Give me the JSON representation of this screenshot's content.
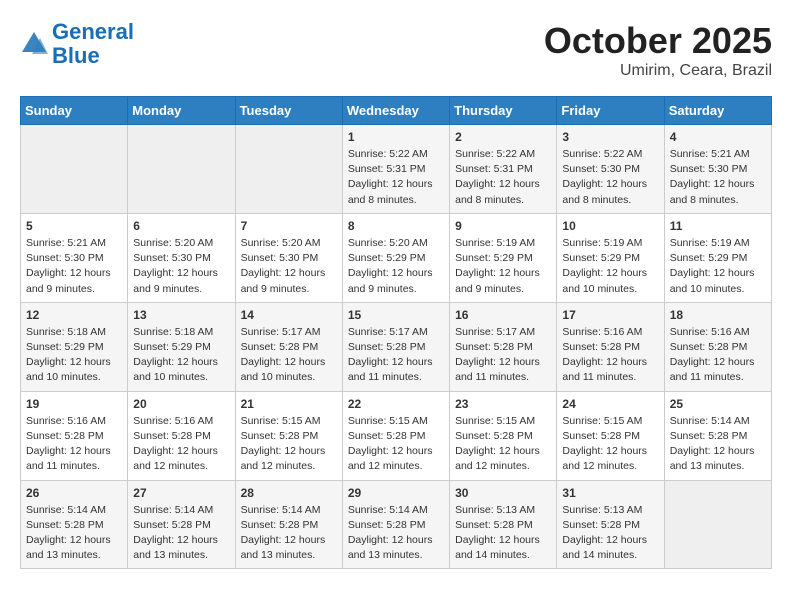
{
  "header": {
    "logo_line1": "General",
    "logo_line2": "Blue",
    "month": "October 2025",
    "location": "Umirim, Ceara, Brazil"
  },
  "days_of_week": [
    "Sunday",
    "Monday",
    "Tuesday",
    "Wednesday",
    "Thursday",
    "Friday",
    "Saturday"
  ],
  "weeks": [
    [
      {
        "day": "",
        "info": ""
      },
      {
        "day": "",
        "info": ""
      },
      {
        "day": "",
        "info": ""
      },
      {
        "day": "1",
        "info": "Sunrise: 5:22 AM\nSunset: 5:31 PM\nDaylight: 12 hours and 8 minutes."
      },
      {
        "day": "2",
        "info": "Sunrise: 5:22 AM\nSunset: 5:31 PM\nDaylight: 12 hours and 8 minutes."
      },
      {
        "day": "3",
        "info": "Sunrise: 5:22 AM\nSunset: 5:30 PM\nDaylight: 12 hours and 8 minutes."
      },
      {
        "day": "4",
        "info": "Sunrise: 5:21 AM\nSunset: 5:30 PM\nDaylight: 12 hours and 8 minutes."
      }
    ],
    [
      {
        "day": "5",
        "info": "Sunrise: 5:21 AM\nSunset: 5:30 PM\nDaylight: 12 hours and 9 minutes."
      },
      {
        "day": "6",
        "info": "Sunrise: 5:20 AM\nSunset: 5:30 PM\nDaylight: 12 hours and 9 minutes."
      },
      {
        "day": "7",
        "info": "Sunrise: 5:20 AM\nSunset: 5:30 PM\nDaylight: 12 hours and 9 minutes."
      },
      {
        "day": "8",
        "info": "Sunrise: 5:20 AM\nSunset: 5:29 PM\nDaylight: 12 hours and 9 minutes."
      },
      {
        "day": "9",
        "info": "Sunrise: 5:19 AM\nSunset: 5:29 PM\nDaylight: 12 hours and 9 minutes."
      },
      {
        "day": "10",
        "info": "Sunrise: 5:19 AM\nSunset: 5:29 PM\nDaylight: 12 hours and 10 minutes."
      },
      {
        "day": "11",
        "info": "Sunrise: 5:19 AM\nSunset: 5:29 PM\nDaylight: 12 hours and 10 minutes."
      }
    ],
    [
      {
        "day": "12",
        "info": "Sunrise: 5:18 AM\nSunset: 5:29 PM\nDaylight: 12 hours and 10 minutes."
      },
      {
        "day": "13",
        "info": "Sunrise: 5:18 AM\nSunset: 5:29 PM\nDaylight: 12 hours and 10 minutes."
      },
      {
        "day": "14",
        "info": "Sunrise: 5:17 AM\nSunset: 5:28 PM\nDaylight: 12 hours and 10 minutes."
      },
      {
        "day": "15",
        "info": "Sunrise: 5:17 AM\nSunset: 5:28 PM\nDaylight: 12 hours and 11 minutes."
      },
      {
        "day": "16",
        "info": "Sunrise: 5:17 AM\nSunset: 5:28 PM\nDaylight: 12 hours and 11 minutes."
      },
      {
        "day": "17",
        "info": "Sunrise: 5:16 AM\nSunset: 5:28 PM\nDaylight: 12 hours and 11 minutes."
      },
      {
        "day": "18",
        "info": "Sunrise: 5:16 AM\nSunset: 5:28 PM\nDaylight: 12 hours and 11 minutes."
      }
    ],
    [
      {
        "day": "19",
        "info": "Sunrise: 5:16 AM\nSunset: 5:28 PM\nDaylight: 12 hours and 11 minutes."
      },
      {
        "day": "20",
        "info": "Sunrise: 5:16 AM\nSunset: 5:28 PM\nDaylight: 12 hours and 12 minutes."
      },
      {
        "day": "21",
        "info": "Sunrise: 5:15 AM\nSunset: 5:28 PM\nDaylight: 12 hours and 12 minutes."
      },
      {
        "day": "22",
        "info": "Sunrise: 5:15 AM\nSunset: 5:28 PM\nDaylight: 12 hours and 12 minutes."
      },
      {
        "day": "23",
        "info": "Sunrise: 5:15 AM\nSunset: 5:28 PM\nDaylight: 12 hours and 12 minutes."
      },
      {
        "day": "24",
        "info": "Sunrise: 5:15 AM\nSunset: 5:28 PM\nDaylight: 12 hours and 12 minutes."
      },
      {
        "day": "25",
        "info": "Sunrise: 5:14 AM\nSunset: 5:28 PM\nDaylight: 12 hours and 13 minutes."
      }
    ],
    [
      {
        "day": "26",
        "info": "Sunrise: 5:14 AM\nSunset: 5:28 PM\nDaylight: 12 hours and 13 minutes."
      },
      {
        "day": "27",
        "info": "Sunrise: 5:14 AM\nSunset: 5:28 PM\nDaylight: 12 hours and 13 minutes."
      },
      {
        "day": "28",
        "info": "Sunrise: 5:14 AM\nSunset: 5:28 PM\nDaylight: 12 hours and 13 minutes."
      },
      {
        "day": "29",
        "info": "Sunrise: 5:14 AM\nSunset: 5:28 PM\nDaylight: 12 hours and 13 minutes."
      },
      {
        "day": "30",
        "info": "Sunrise: 5:13 AM\nSunset: 5:28 PM\nDaylight: 12 hours and 14 minutes."
      },
      {
        "day": "31",
        "info": "Sunrise: 5:13 AM\nSunset: 5:28 PM\nDaylight: 12 hours and 14 minutes."
      },
      {
        "day": "",
        "info": ""
      }
    ]
  ]
}
